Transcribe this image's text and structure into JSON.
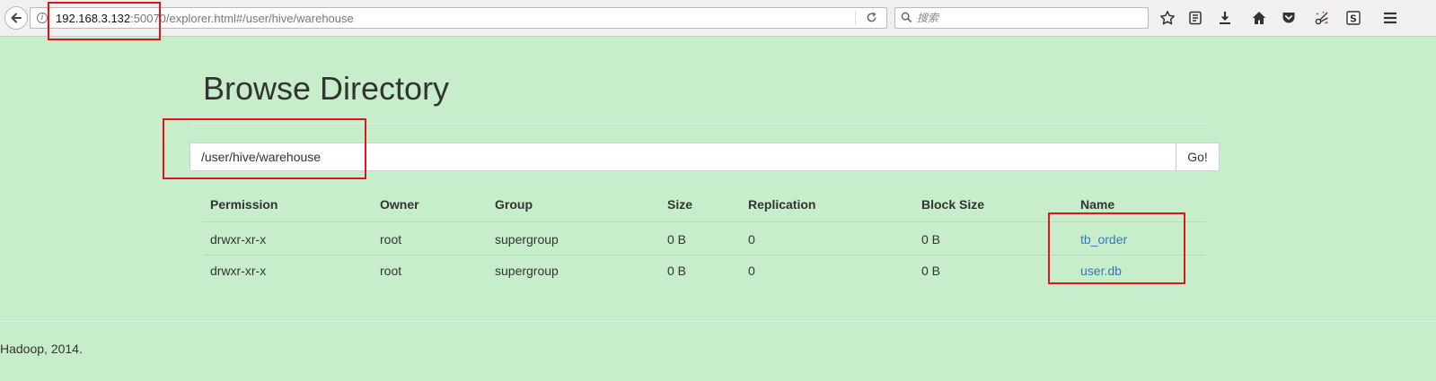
{
  "browser": {
    "url_host": "192.168.3.132",
    "url_rest": ":50070/explorer.html#/user/hive/warehouse",
    "search_placeholder": "搜索"
  },
  "page": {
    "title": "Browse Directory",
    "path_value": "/user/hive/warehouse",
    "go_label": "Go!"
  },
  "table": {
    "headers": {
      "permission": "Permission",
      "owner": "Owner",
      "group": "Group",
      "size": "Size",
      "replication": "Replication",
      "block_size": "Block Size",
      "name": "Name"
    },
    "rows": [
      {
        "permission": "drwxr-xr-x",
        "owner": "root",
        "group": "supergroup",
        "size": "0 B",
        "replication": "0",
        "block_size": "0 B",
        "name": "tb_order"
      },
      {
        "permission": "drwxr-xr-x",
        "owner": "root",
        "group": "supergroup",
        "size": "0 B",
        "replication": "0",
        "block_size": "0 B",
        "name": "user.db"
      }
    ]
  },
  "footer": {
    "text": "Hadoop, 2014."
  },
  "colors": {
    "background": "#c8edcb",
    "link": "#337ab7",
    "annotation": "#e0151b"
  }
}
